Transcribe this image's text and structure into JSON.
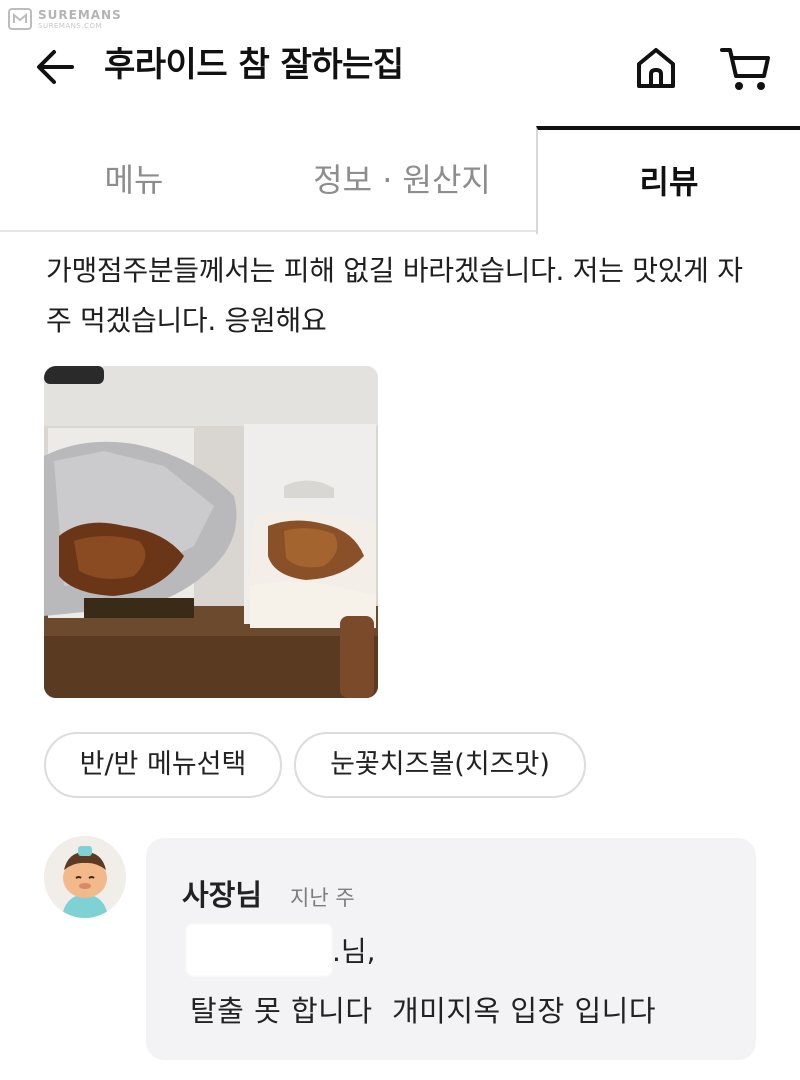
{
  "watermark": {
    "brand": "SUREMANS",
    "domain": "SUREMANS.COM"
  },
  "header": {
    "title": "후라이드 참 잘하는집",
    "back_icon": "arrow-left-icon",
    "home_icon": "home-icon",
    "cart_icon": "cart-icon"
  },
  "tabs": [
    {
      "label": "메뉴",
      "active": false
    },
    {
      "label": "정보 · 원산지",
      "active": false
    },
    {
      "label": "리뷰",
      "active": true
    }
  ],
  "review": {
    "text": "가맹점주분들께서는 피해 없길 바라겠습니다. 저는 맛있게 자주 먹겠습니다. 응원해요",
    "options": [
      "반/반 메뉴선택",
      "눈꽃치즈볼(치즈맛)"
    ]
  },
  "reply": {
    "author": "사장님",
    "time": "지난 주",
    "name_suffix": ".님,",
    "body": "탈출 못 합니다  개미지옥 입장 입니다"
  },
  "colors": {
    "active_tab": "#111111",
    "inactive_tab": "#8d8d8d",
    "reply_bg": "#f3f3f5",
    "chip_border": "#dcdcdc"
  }
}
